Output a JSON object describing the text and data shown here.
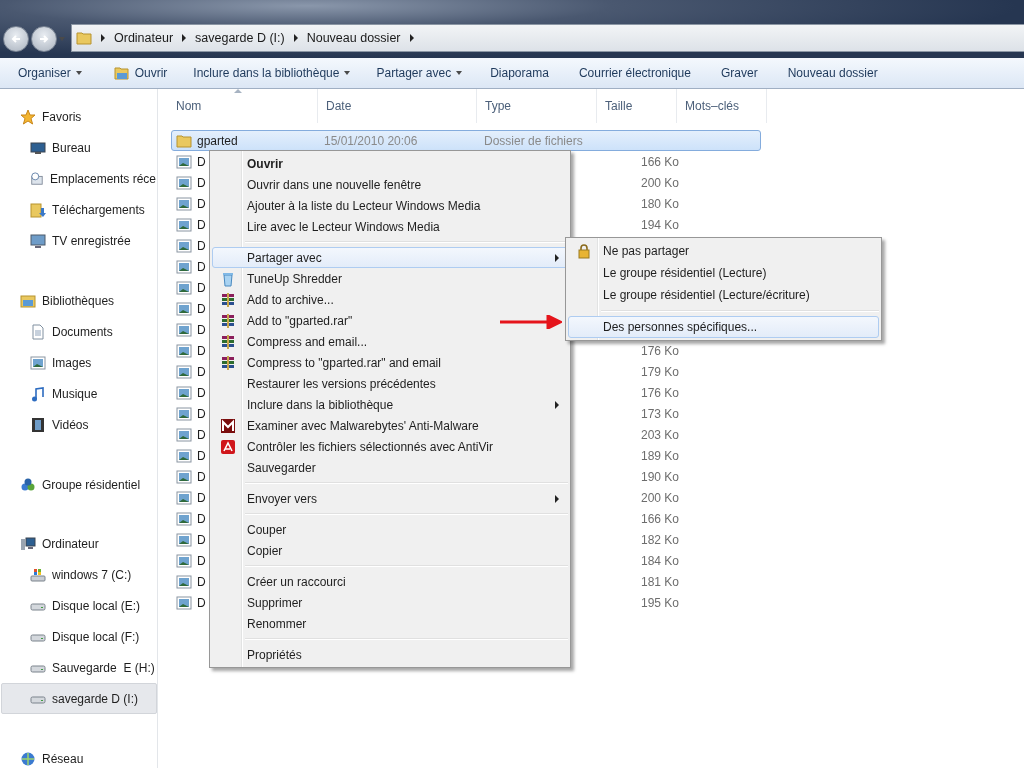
{
  "address_bar": {
    "crumbs": [
      "Ordinateur",
      "savegarde D (I:)",
      "Nouveau dossier"
    ]
  },
  "toolbar": [
    {
      "label": "Organiser",
      "kind": "dropdown"
    },
    {
      "label": "Ouvrir",
      "kind": "icon"
    },
    {
      "label": "Inclure dans la bibliothèque",
      "kind": "dropdown"
    },
    {
      "label": "Partager avec",
      "kind": "dropdown"
    },
    {
      "label": "Diaporama",
      "kind": "plain"
    },
    {
      "label": "Courrier électronique",
      "kind": "plain"
    },
    {
      "label": "Graver",
      "kind": "plain"
    },
    {
      "label": "Nouveau dossier",
      "kind": "plain"
    }
  ],
  "sidebar": {
    "groups": [
      {
        "label": "Favoris",
        "kind": "star",
        "selected": false,
        "children": [
          {
            "label": "Bureau",
            "kind": "desktop",
            "selected": false
          },
          {
            "label": "Emplacements réce",
            "kind": "recent",
            "selected": false
          },
          {
            "label": "Téléchargements",
            "kind": "downloads",
            "selected": false
          },
          {
            "label": "TV enregistrée",
            "kind": "tv",
            "selected": false
          }
        ]
      },
      {
        "label": "Bibliothèques",
        "kind": "library",
        "selected": false,
        "children": [
          {
            "label": "Documents",
            "kind": "document",
            "selected": false
          },
          {
            "label": "Images",
            "kind": "images",
            "selected": false
          },
          {
            "label": "Musique",
            "kind": "music",
            "selected": false
          },
          {
            "label": "Vidéos",
            "kind": "videos",
            "selected": false
          }
        ]
      },
      {
        "label": "Groupe résidentiel",
        "kind": "homegroup",
        "selected": false
      },
      {
        "label": "Ordinateur",
        "kind": "computer",
        "selected": false,
        "children": [
          {
            "label": "windows 7 (C:)",
            "kind": "system-drive",
            "selected": false
          },
          {
            "label": "Disque local (E:)",
            "kind": "drive",
            "selected": false
          },
          {
            "label": "Disque local (F:)",
            "kind": "drive",
            "selected": false
          },
          {
            "label": "Sauvegarde  E (H:)",
            "kind": "drive",
            "selected": false
          },
          {
            "label": "savegarde D (I:)",
            "kind": "drive",
            "selected": true
          }
        ]
      },
      {
        "label": "Réseau",
        "kind": "network",
        "selected": false
      }
    ]
  },
  "columns": [
    {
      "label": "Nom",
      "sorted": true
    },
    {
      "label": "Date",
      "sorted": false
    },
    {
      "label": "Type",
      "sorted": false
    },
    {
      "label": "Taille",
      "sorted": false
    },
    {
      "label": "Mots–clés",
      "sorted": false
    }
  ],
  "rows": [
    {
      "name": "gparted",
      "date": "15/01/2010 20:06",
      "type": "Dossier de fichiers",
      "kind": "folder",
      "selected": true
    },
    {
      "name": "D",
      "size": "166 Ko",
      "kind": "image",
      "selected": false
    },
    {
      "name": "D",
      "size": "200 Ko",
      "kind": "image",
      "selected": false
    },
    {
      "name": "D",
      "size": "180 Ko",
      "kind": "image",
      "selected": false
    },
    {
      "name": "D",
      "size": "194 Ko",
      "kind": "image",
      "selected": false
    },
    {
      "name": "D",
      "kind": "image",
      "selected": false
    },
    {
      "name": "D",
      "kind": "image",
      "selected": false
    },
    {
      "name": "D",
      "kind": "image",
      "selected": false
    },
    {
      "name": "D",
      "kind": "image",
      "selected": false
    },
    {
      "name": "D",
      "kind": "image",
      "selected": false
    },
    {
      "name": "D",
      "size": "176 Ko",
      "kind": "image",
      "selected": false
    },
    {
      "name": "D",
      "size": "179 Ko",
      "kind": "image",
      "selected": false
    },
    {
      "name": "D",
      "size": "176 Ko",
      "kind": "image",
      "selected": false
    },
    {
      "name": "D",
      "size": "173 Ko",
      "kind": "image",
      "selected": false
    },
    {
      "name": "D",
      "size": "203 Ko",
      "kind": "image",
      "selected": false
    },
    {
      "name": "D",
      "size": "189 Ko",
      "kind": "image",
      "selected": false
    },
    {
      "name": "D",
      "size": "190 Ko",
      "kind": "image",
      "selected": false
    },
    {
      "name": "D",
      "size": "200 Ko",
      "kind": "image",
      "selected": false
    },
    {
      "name": "D",
      "size": "166 Ko",
      "kind": "image",
      "selected": false
    },
    {
      "name": "D",
      "size": "182 Ko",
      "kind": "image",
      "selected": false
    },
    {
      "name": "D",
      "size": "184 Ko",
      "kind": "image",
      "selected": false
    },
    {
      "name": "D",
      "size": "181 Ko",
      "kind": "image",
      "selected": false
    },
    {
      "name": "D",
      "size": "195 Ko",
      "kind": "image",
      "selected": false
    }
  ],
  "context_menu": {
    "groups": [
      [
        {
          "label": "Ouvrir",
          "kind": "default",
          "highlighted": false,
          "submenu": false
        },
        {
          "label": "Ouvrir dans une nouvelle fenêtre",
          "kind": "plain",
          "highlighted": false,
          "submenu": false
        },
        {
          "label": "Ajouter à la liste du Lecteur Windows Media",
          "kind": "plain",
          "highlighted": false,
          "submenu": false
        },
        {
          "label": "Lire avec le Lecteur Windows Media",
          "kind": "plain",
          "highlighted": false,
          "submenu": false
        }
      ],
      [
        {
          "label": "Partager avec",
          "kind": "plain",
          "highlighted": true,
          "submenu": true
        },
        {
          "label": "TuneUp Shredder",
          "kind": "shredder",
          "highlighted": false,
          "submenu": false
        },
        {
          "label": "Add to archive...",
          "kind": "archive",
          "highlighted": false,
          "submenu": false
        },
        {
          "label": "Add to \"gparted.rar\"",
          "kind": "archive",
          "highlighted": false,
          "submenu": false
        },
        {
          "label": "Compress and email...",
          "kind": "archive",
          "highlighted": false,
          "submenu": false
        },
        {
          "label": "Compress to \"gparted.rar\" and email",
          "kind": "archive",
          "highlighted": false,
          "submenu": false
        },
        {
          "label": "Restaurer les versions précédentes",
          "kind": "plain",
          "highlighted": false,
          "submenu": false
        },
        {
          "label": "Inclure dans la bibliothèque",
          "kind": "plain",
          "highlighted": false,
          "submenu": true
        },
        {
          "label": "Examiner avec Malwarebytes' Anti-Malware",
          "kind": "scanner",
          "highlighted": false,
          "submenu": false
        },
        {
          "label": "Contrôler les fichiers sélectionnés avec AntiVir",
          "kind": "antivirus",
          "highlighted": false,
          "submenu": false
        },
        {
          "label": "Sauvegarder",
          "kind": "plain",
          "highlighted": false,
          "submenu": false
        }
      ],
      [
        {
          "label": "Envoyer vers",
          "kind": "plain",
          "highlighted": false,
          "submenu": true
        }
      ],
      [
        {
          "label": "Couper",
          "kind": "plain",
          "highlighted": false,
          "submenu": false
        },
        {
          "label": "Copier",
          "kind": "plain",
          "highlighted": false,
          "submenu": false
        }
      ],
      [
        {
          "label": "Créer un raccourci",
          "kind": "plain",
          "highlighted": false,
          "submenu": false
        },
        {
          "label": "Supprimer",
          "kind": "plain",
          "highlighted": false,
          "submenu": false
        },
        {
          "label": "Renommer",
          "kind": "plain",
          "highlighted": false,
          "submenu": false
        }
      ],
      [
        {
          "label": "Propriétés",
          "kind": "plain",
          "highlighted": false,
          "submenu": false
        }
      ]
    ]
  },
  "share_submenu": {
    "groups": [
      [
        {
          "label": "Ne pas partager",
          "kind": "lock",
          "highlighted": false
        },
        {
          "label": "Le groupe résidentiel (Lecture)",
          "kind": "plain",
          "highlighted": false
        },
        {
          "label": "Le groupe résidentiel (Lecture/écriture)",
          "kind": "plain",
          "highlighted": false
        }
      ],
      [
        {
          "label": "Des personnes spécifiques...",
          "kind": "plain",
          "highlighted": true
        }
      ]
    ]
  }
}
